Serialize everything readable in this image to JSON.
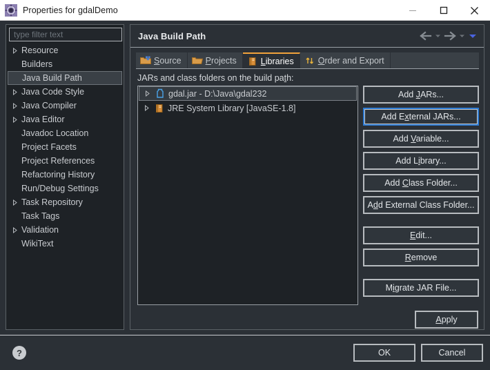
{
  "window": {
    "title": "Properties for gdalDemo",
    "icon": "properties-gear-icon",
    "minimize_label": "Minimize",
    "maximize_label": "Maximize",
    "close_label": "Close"
  },
  "sidebar": {
    "filter": {
      "placeholder": "type filter text",
      "value": ""
    },
    "items": [
      {
        "label": "Resource",
        "expandable": true,
        "selected": false
      },
      {
        "label": "Builders",
        "expandable": false,
        "selected": false
      },
      {
        "label": "Java Build Path",
        "expandable": false,
        "selected": true
      },
      {
        "label": "Java Code Style",
        "expandable": true,
        "selected": false
      },
      {
        "label": "Java Compiler",
        "expandable": true,
        "selected": false
      },
      {
        "label": "Java Editor",
        "expandable": true,
        "selected": false
      },
      {
        "label": "Javadoc Location",
        "expandable": false,
        "selected": false
      },
      {
        "label": "Project Facets",
        "expandable": false,
        "selected": false
      },
      {
        "label": "Project References",
        "expandable": false,
        "selected": false
      },
      {
        "label": "Refactoring History",
        "expandable": false,
        "selected": false
      },
      {
        "label": "Run/Debug Settings",
        "expandable": false,
        "selected": false
      },
      {
        "label": "Task Repository",
        "expandable": true,
        "selected": false
      },
      {
        "label": "Task Tags",
        "expandable": false,
        "selected": false
      },
      {
        "label": "Validation",
        "expandable": true,
        "selected": false
      },
      {
        "label": "WikiText",
        "expandable": false,
        "selected": false
      }
    ]
  },
  "content": {
    "title": "Java Build Path",
    "nav": {
      "back_label": "Back",
      "back_menu_label": "Back history",
      "forward_label": "Forward",
      "forward_menu_label": "Forward history",
      "menu_label": "View menu"
    },
    "tabs": [
      {
        "label": "Source",
        "mnemonic": "S",
        "icon": "source-folder-icon",
        "active": false
      },
      {
        "label": "Projects",
        "mnemonic": "P",
        "icon": "projects-folder-icon",
        "active": false
      },
      {
        "label": "Libraries",
        "mnemonic": "L",
        "icon": "library-book-icon",
        "active": true
      },
      {
        "label": "Order and Export",
        "mnemonic": "O",
        "icon": "order-arrows-icon",
        "active": false
      }
    ],
    "list_caption": "JARs and class folders on the build path:",
    "list_caption_mnemonic": "t",
    "entries": [
      {
        "label": "gdal.jar - D:\\Java\\gdal232",
        "icon": "jar-icon",
        "selected": true,
        "expandable": true
      },
      {
        "label": "JRE System Library [JavaSE-1.8]",
        "icon": "library-book-icon",
        "selected": false,
        "expandable": true
      }
    ],
    "buttons": [
      {
        "label": "Add JARs...",
        "mnemonic": "J",
        "focused": false,
        "gap_after": "sm"
      },
      {
        "label": "Add External JARs...",
        "mnemonic": "x",
        "focused": true,
        "gap_after": "sm"
      },
      {
        "label": "Add Variable...",
        "mnemonic": "V",
        "focused": false,
        "gap_after": "sm"
      },
      {
        "label": "Add Library...",
        "mnemonic": "i",
        "focused": false,
        "gap_after": "sm"
      },
      {
        "label": "Add Class Folder...",
        "mnemonic": "C",
        "focused": false,
        "gap_after": "sm"
      },
      {
        "label": "Add External Class Folder...",
        "mnemonic": "d",
        "focused": false,
        "gap_after": "lg"
      },
      {
        "label": "Edit...",
        "mnemonic": "E",
        "focused": false,
        "gap_after": "sm"
      },
      {
        "label": "Remove",
        "mnemonic": "R",
        "focused": false,
        "gap_after": "lg"
      },
      {
        "label": "Migrate JAR File...",
        "mnemonic": "i",
        "focused": false,
        "gap_after": "sm"
      }
    ],
    "apply_label": "Apply",
    "apply_mnemonic": "A"
  },
  "footer": {
    "help_label": "?",
    "ok_label": "OK",
    "cancel_label": "Cancel"
  },
  "colors": {
    "window_bg": "#2b3036",
    "panel_bg": "#1e2226",
    "titlebar_bg": "#ffffff",
    "accent_tab": "#f2a33c",
    "focus_blue": "#2d7bd4",
    "text": "#d6d9dc",
    "muted_text": "#6d747b",
    "jar_icon": "#4aa3e8",
    "library_icon": "#d98f3a"
  }
}
